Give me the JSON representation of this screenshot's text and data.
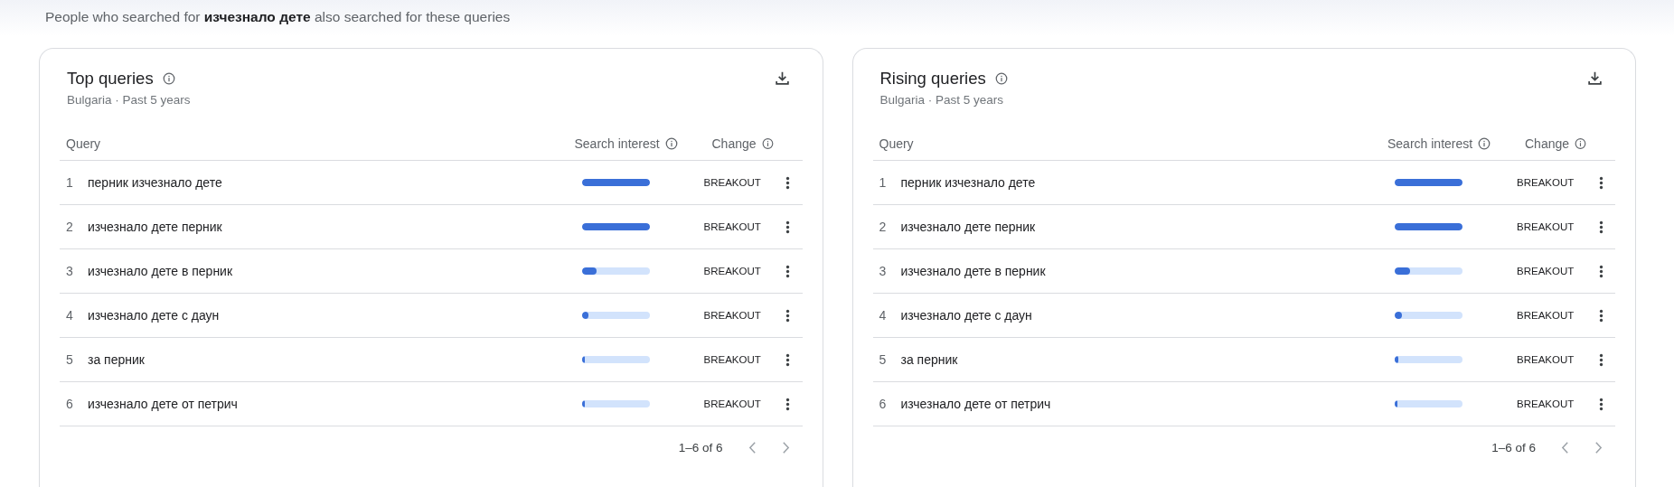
{
  "intro": "People who searched for **изчезнало дете** also searched for these queries",
  "cards": [
    {
      "title": "Top queries",
      "subtitle": "Bulgaria · Past 5 years",
      "columns": [
        "Query",
        "Search interest",
        "Change"
      ],
      "rows": [
        {
          "rank": "1",
          "query": "перник изчезнало дете",
          "level": 1,
          "change": "BREAKOUT"
        },
        {
          "rank": "2",
          "query": "изчезнало дете перник",
          "level": 1,
          "change": "BREAKOUT"
        },
        {
          "rank": "3",
          "query": "изчезнало дете в перник",
          "level": 0.22,
          "change": "BREAKOUT"
        },
        {
          "rank": "4",
          "query": "изчезнало дете с даун",
          "level": 0.1,
          "change": "BREAKOUT"
        },
        {
          "rank": "5",
          "query": "за перник",
          "level": 0.05,
          "change": "BREAKOUT"
        },
        {
          "rank": "6",
          "query": "изчезнало дете от петрич",
          "level": 0.03,
          "change": "BREAKOUT"
        }
      ],
      "pagination": "1–6 of 6"
    },
    {
      "title": "Rising queries",
      "subtitle": "Bulgaria · Past 5 years",
      "columns": [
        "Query",
        "Search interest",
        "Change"
      ],
      "rows": [
        {
          "rank": "1",
          "query": "перник изчезнало дете",
          "level": 1,
          "change": "BREAKOUT"
        },
        {
          "rank": "2",
          "query": "изчезнало дете перник",
          "level": 1,
          "change": "BREAKOUT"
        },
        {
          "rank": "3",
          "query": "изчезнало дете в перник",
          "level": 0.22,
          "change": "BREAKOUT"
        },
        {
          "rank": "4",
          "query": "изчезнало дете с даун",
          "level": 0.1,
          "change": "BREAKOUT"
        },
        {
          "rank": "5",
          "query": "за перник",
          "level": 0.05,
          "change": "BREAKOUT"
        },
        {
          "rank": "6",
          "query": "изчезнало дете от петрич",
          "level": 0.03,
          "change": "BREAKOUT"
        }
      ],
      "pagination": "1–6 of 6"
    }
  ]
}
